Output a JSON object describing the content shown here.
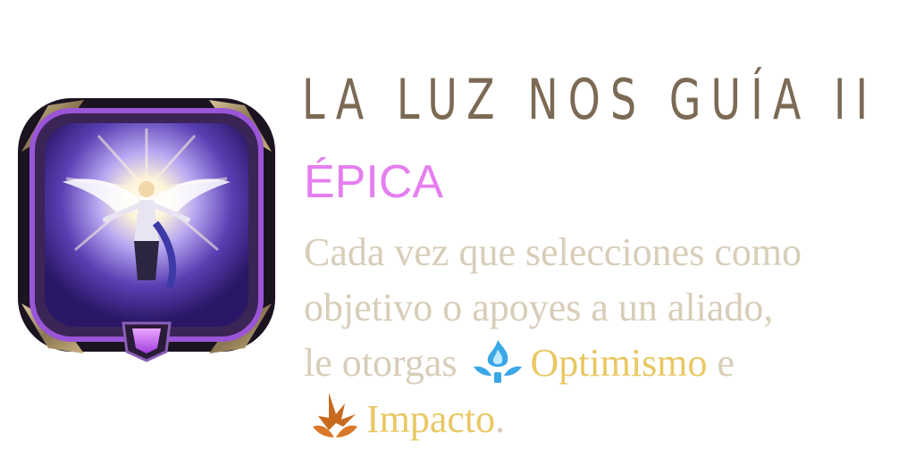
{
  "relic": {
    "title": "LA LUZ NOS GUÍA II",
    "rarity": "ÉPICA",
    "icon": "lux-winged-champion-relic-icon",
    "description": {
      "line1": "Cada vez que selecciones como",
      "line2": "objetivo o apoyes a un aliado,",
      "line3_text": "le otorgas",
      "keyword1": "Optimismo",
      "conjunction": "e",
      "keyword2": "Impacto",
      "ending": "."
    }
  },
  "keyword_icons": {
    "optimism": "blue-flame-icon",
    "impact": "orange-impact-icon"
  },
  "colors": {
    "title": "#7c6a55",
    "rarity": "#e57ef0",
    "description": "#d8cdb8",
    "keyword": "#e9c863",
    "frame_purple": "#7a3fb8",
    "gem": "#c25af0"
  }
}
